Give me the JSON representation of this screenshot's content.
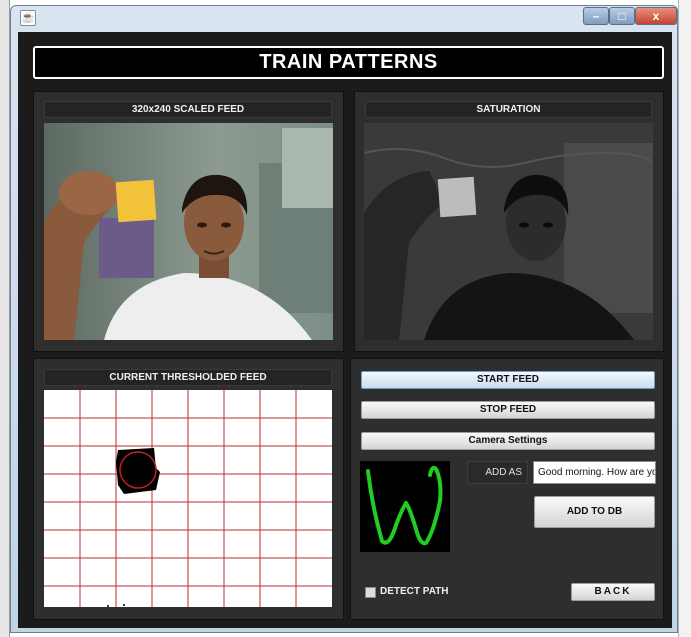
{
  "window": {
    "icon_glyph": "☕",
    "minimize_glyph": "–",
    "maximize_glyph": "□",
    "close_glyph": "x"
  },
  "header": {
    "title": "TRAIN PATTERNS"
  },
  "panels": {
    "feed_label": "320x240 SCALED FEED",
    "saturation_label": "SATURATION",
    "thresholded_label": "CURRENT THRESHOLDED FEED"
  },
  "controls": {
    "start_feed": "START FEED",
    "stop_feed": "STOP FEED",
    "camera_settings": "Camera Settings",
    "add_as_label": "ADD AS",
    "add_as_value": "Good morning. How are yo",
    "add_to_db": "ADD TO DB",
    "detect_path_label": "DETECT PATH",
    "detect_path_checked": false,
    "back": "BACK"
  },
  "colors": {
    "background": "#1b1b1b",
    "panel": "#2e2e2e",
    "grid_line": "#b53030",
    "pattern_stroke": "#22cc22",
    "sticky_note": "#f2c33a"
  },
  "icons": [
    "java-icon",
    "minimize-icon",
    "maximize-icon",
    "close-icon"
  ]
}
